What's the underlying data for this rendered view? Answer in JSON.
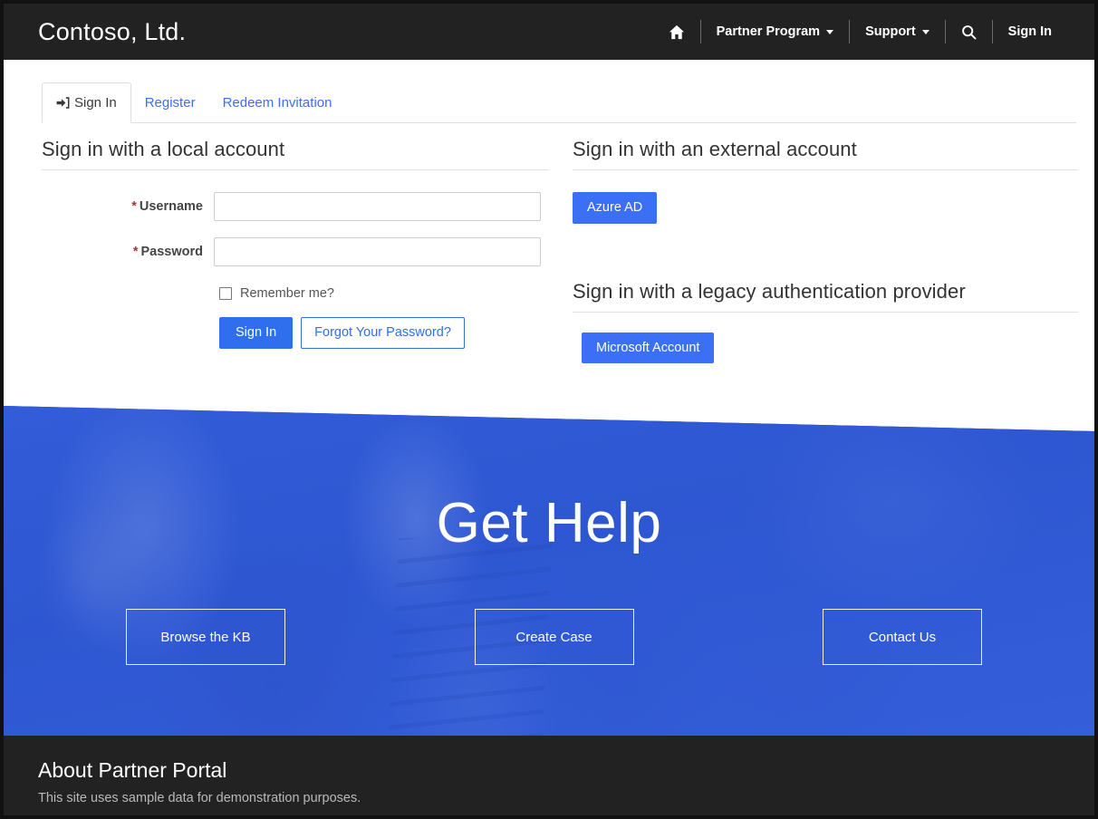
{
  "navbar": {
    "brand": "Contoso, Ltd.",
    "home_icon": "home-icon",
    "search_icon": "search-icon",
    "items": [
      {
        "label": "Partner Program",
        "has_caret": true
      },
      {
        "label": "Support",
        "has_caret": true
      }
    ],
    "sign_in": "Sign In"
  },
  "tabs": [
    {
      "label": "Sign In",
      "icon": "sign-in-icon",
      "active": true
    },
    {
      "label": "Register",
      "active": false
    },
    {
      "label": "Redeem Invitation",
      "active": false
    }
  ],
  "local_account": {
    "title": "Sign in with a local account",
    "username": {
      "label": "Username",
      "required_marker": "*",
      "value": "",
      "placeholder": ""
    },
    "password": {
      "label": "Password",
      "required_marker": "*",
      "value": "",
      "placeholder": ""
    },
    "remember_me_label": "Remember me?",
    "remember_me_checked": false,
    "sign_in_button": "Sign In",
    "forgot_password_button": "Forgot Your Password?"
  },
  "external_account": {
    "title": "Sign in with an external account",
    "providers": [
      {
        "label": "Azure AD"
      }
    ]
  },
  "legacy_provider": {
    "title": "Sign in with a legacy authentication provider",
    "providers": [
      {
        "label": "Microsoft Account"
      }
    ]
  },
  "hero": {
    "title": "Get Help",
    "buttons": [
      {
        "label": "Browse the KB"
      },
      {
        "label": "Create Case"
      },
      {
        "label": "Contact Us"
      }
    ]
  },
  "footer": {
    "title": "About Partner Portal",
    "text": "This site uses sample data for demonstration purposes."
  },
  "colors": {
    "nav_background": "#222222",
    "primary_blue": "#2f6fed",
    "external_blue": "#3b6ff5",
    "hero_blue": "#2f5fd8",
    "required_red": "#9b3b3b",
    "link_blue": "#3b6ff5",
    "page_border": "#111111"
  }
}
